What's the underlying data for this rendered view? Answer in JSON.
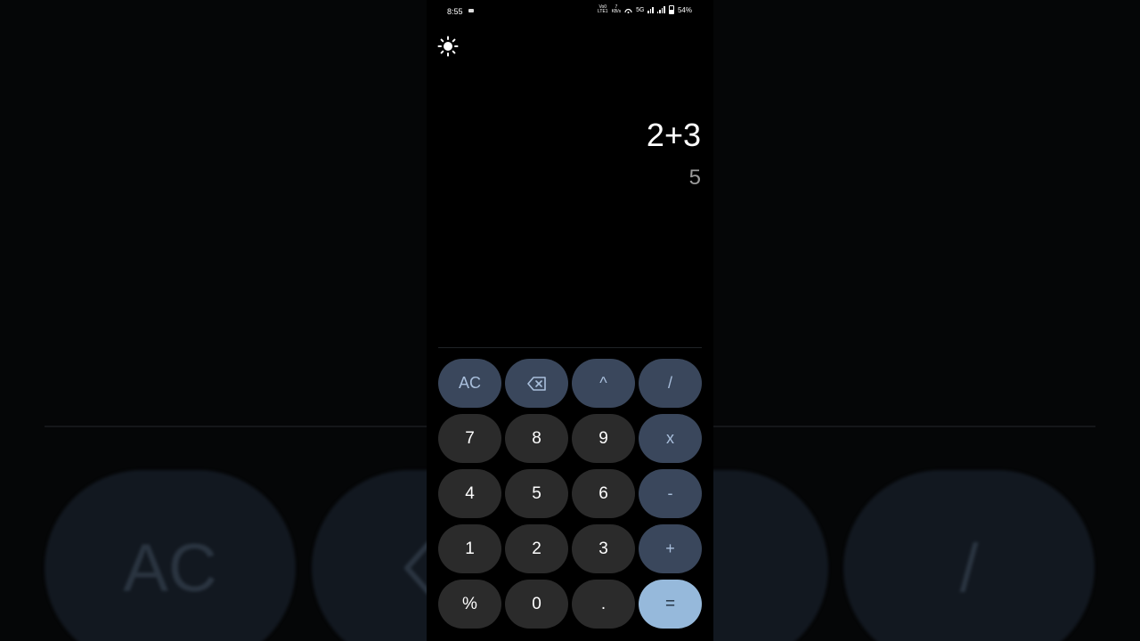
{
  "status_bar": {
    "time": "8:55",
    "volte_top": "Vo0",
    "volte_bottom": "LTE1",
    "speed_top": "7",
    "speed_bottom": "KB/s",
    "network": "5G",
    "battery": "54%"
  },
  "display": {
    "expression": "2+3",
    "result": "5"
  },
  "keys": [
    {
      "label": "AC",
      "kind": "op",
      "name": "clear-button"
    },
    {
      "label": "",
      "kind": "op",
      "name": "backspace-button",
      "icon": "backspace-icon"
    },
    {
      "label": "^",
      "kind": "op",
      "name": "power-button"
    },
    {
      "label": "/",
      "kind": "op",
      "name": "divide-button"
    },
    {
      "label": "7",
      "kind": "num",
      "name": "digit-7-button"
    },
    {
      "label": "8",
      "kind": "num",
      "name": "digit-8-button"
    },
    {
      "label": "9",
      "kind": "num",
      "name": "digit-9-button"
    },
    {
      "label": "x",
      "kind": "op",
      "name": "multiply-button"
    },
    {
      "label": "4",
      "kind": "num",
      "name": "digit-4-button"
    },
    {
      "label": "5",
      "kind": "num",
      "name": "digit-5-button"
    },
    {
      "label": "6",
      "kind": "num",
      "name": "digit-6-button"
    },
    {
      "label": "-",
      "kind": "op",
      "name": "subtract-button"
    },
    {
      "label": "1",
      "kind": "num",
      "name": "digit-1-button"
    },
    {
      "label": "2",
      "kind": "num",
      "name": "digit-2-button"
    },
    {
      "label": "3",
      "kind": "num",
      "name": "digit-3-button"
    },
    {
      "label": "+",
      "kind": "op",
      "name": "add-button"
    },
    {
      "label": "%",
      "kind": "num",
      "name": "percent-button"
    },
    {
      "label": "0",
      "kind": "num",
      "name": "digit-0-button"
    },
    {
      "label": ".",
      "kind": "num",
      "name": "decimal-button"
    },
    {
      "label": "=",
      "kind": "eq",
      "name": "equals-button"
    }
  ],
  "background_keys": {
    "left_label": "AC",
    "right_label": "/"
  },
  "colors": {
    "operator_key": "#3a475c",
    "number_key": "#2b2b2b",
    "equals_key": "#96b9db",
    "operator_text": "#a9bfdc"
  },
  "icons": {
    "theme_toggle": "sun-icon",
    "backspace": "backspace-icon"
  }
}
